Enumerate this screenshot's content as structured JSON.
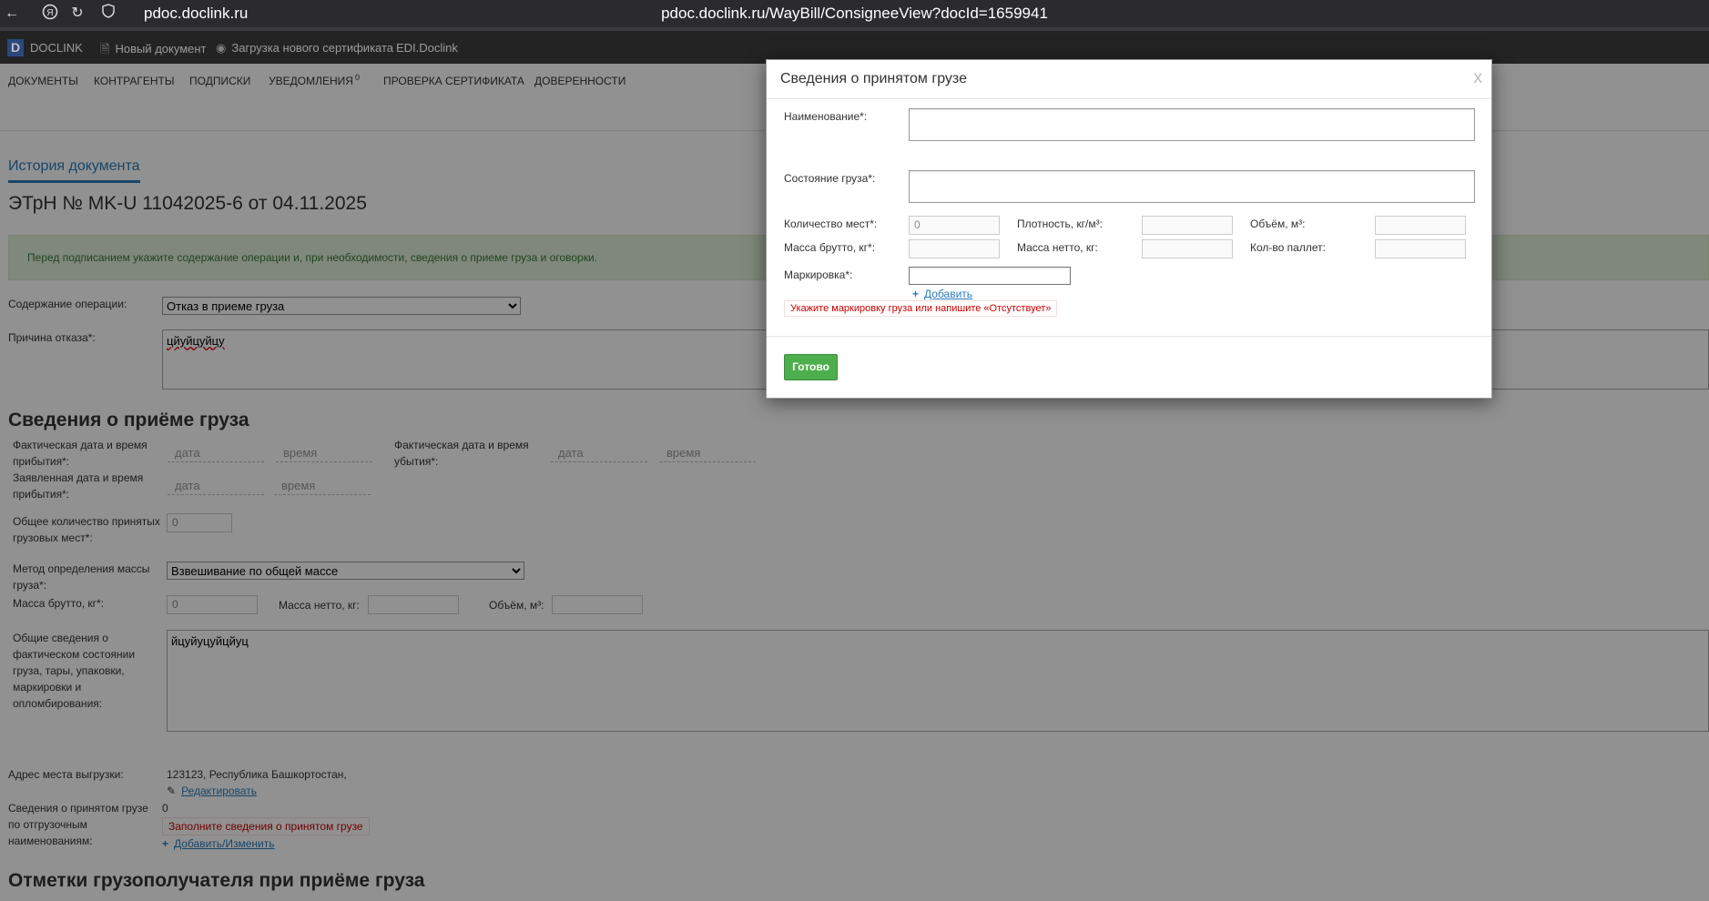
{
  "browser": {
    "host": "pdoc.doclink.ru",
    "url": "pdoc.doclink.ru/WayBill/ConsigneeView?docId=1659941"
  },
  "appbar": {
    "logo_letter": "D",
    "logo_text": "DOCLINK",
    "new_doc": "Новый документ",
    "upload_cert": "Загрузка нового сертификата",
    "edi": "EDI.Doclink"
  },
  "nav": {
    "documents": "ДОКУМЕНТЫ",
    "contractors": "КОНТРАГЕНТЫ",
    "subscriptions": "ПОДПИСКИ",
    "notifications": "УВЕДОМЛЕНИЯ",
    "notifications_count": "0",
    "cert_check": "ПРОВЕРКА СЕРТИФИКАТА",
    "powers": "ДОВЕРЕННОСТИ"
  },
  "page": {
    "history_tab": "История документа",
    "doc_title": "ЭТрН №   MK-U 11042025-6  от   04.11.2025",
    "alert": "Перед подписанием укажите содержание операции и, при необходимости, сведения о приеме груза и оговорки.",
    "operation_label": "Содержание операции:",
    "operation_value": "Отказ в приеме груза",
    "refusal_label": "Причина отказа*:",
    "refusal_value": "цйуйцуйцу",
    "section_receipt": "Сведения о приёме груза",
    "actual_arrival_label": "Фактическая дата и время прибытия*:",
    "declared_arrival_label": "Заявленная дата и время прибытия*:",
    "actual_departure_label": "Фактическая дата и время убытия*:",
    "date_ph": "дата",
    "time_ph": "время",
    "total_places_label": "Общее количество принятых грузовых мест*:",
    "total_places_value": "0",
    "mass_method_label": "Метод определения массы груза*:",
    "mass_method_value": "Взвешивание по общей массе",
    "gross_label": "Масса брутто, кг*:",
    "gross_value": "0",
    "net_label": "Масса нетто, кг:",
    "volume_label": "Объём, м³:",
    "general_info_label": "Общие сведения о фактическом состоянии груза, тары, упаковки, маркировки и опломбирования:",
    "general_info_value": "йцуйуцуйцйуц",
    "address_label": "Адрес места выгрузки:",
    "address_value": "123123, Республика Башкортостан,",
    "edit_link": "Редактировать",
    "cargo_items_label": "Сведения о принятом грузе по отгрузочным наименованиям:",
    "cargo_items_count": "0",
    "fill_error": "Заполните сведения о принятом грузе",
    "add_change_link": "Добавить/Изменить",
    "section_marks": "Отметки грузополучателя при приёме груза"
  },
  "modal": {
    "title": "Сведения о принятом грузе",
    "close": "x",
    "name_label": "Наименование*:",
    "state_label": "Состояние груза*:",
    "places_label": "Количество мест*:",
    "places_value": "0",
    "density_label": "Плотность, кг/м³:",
    "volume_label": "Объём, м³:",
    "gross_label": "Масса брутто, кг*:",
    "net_label": "Масса нетто, кг:",
    "pallets_label": "Кол-во паллет:",
    "marking_label": "Маркировка*:",
    "add_link": "Добавить",
    "marking_error": "Укажите маркировку груза или напишите «Отсутствует»",
    "done_button": "Готово"
  }
}
